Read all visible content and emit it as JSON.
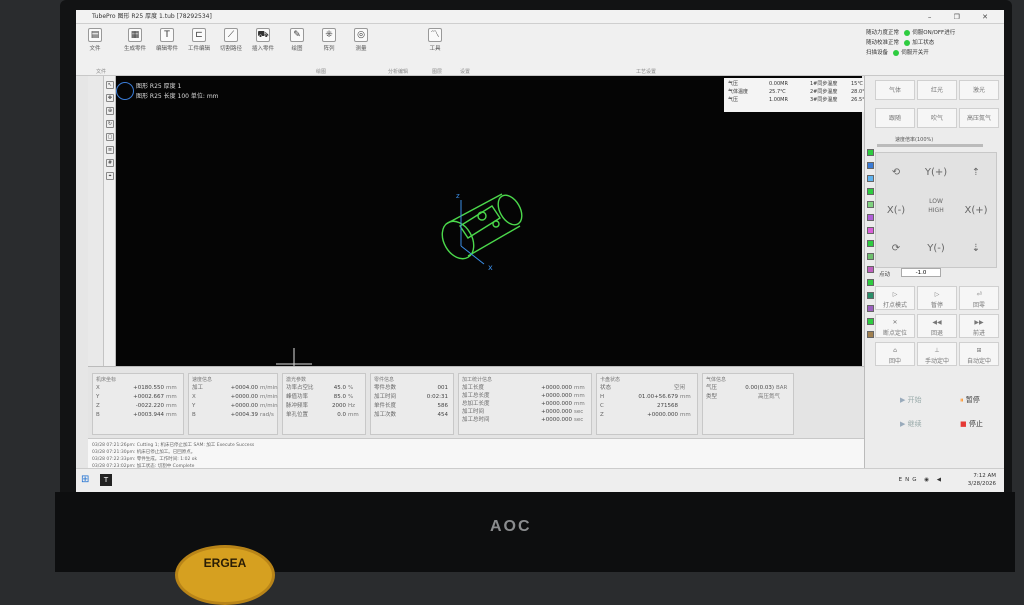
{
  "window": {
    "title": "TubePro 图形 R25 厚度 1.tub [78292534]",
    "controls": "– ❐ ✕"
  },
  "ribbon": {
    "buttons": [
      "文件",
      "生成零件",
      "编辑零件",
      "工件编辑",
      "切割路径",
      "插入零件",
      "绘图",
      "阵列",
      "测量",
      "工具"
    ],
    "groups": [
      "文件",
      "绘图",
      "分析编辑",
      "图层",
      "设置",
      "工艺设置"
    ]
  },
  "status": {
    "items": [
      "随动力度正常",
      "随动校准正常",
      "扫描设备",
      "伺服ON/OFF进行",
      "加工状态",
      "伺服开关开"
    ]
  },
  "part": {
    "line1": "图形 R25 厚度 1",
    "line2": "图形 R25 长度 100 单位: mm"
  },
  "sensors": {
    "rows": [
      [
        "气压",
        "0.00MR",
        "1#同步温度",
        "15℃"
      ],
      [
        "气体温度",
        "25.7℃",
        "2#同步温度",
        "28.0℃"
      ],
      [
        "气压",
        "1.00MR",
        "3#同步温度",
        "26.5℃"
      ]
    ]
  },
  "right_panel": {
    "top_buttons": [
      "气体",
      "红光",
      "激光",
      "跟随",
      "吹气",
      "高压氮气"
    ],
    "jog": {
      "left": "X(-)",
      "right": "X(+)",
      "yplus": "Y(+)",
      "yminus": "Y(-)",
      "low": "LOW",
      "high": "HIGH"
    },
    "speed_label": "速度倍率(100%)",
    "step_label": "点动",
    "step_value": "-1.0",
    "controls": [
      "打点模式",
      "暂停",
      "回零",
      "断点定位",
      "回退",
      "前进",
      "回中",
      "手动定中",
      "自动定中"
    ],
    "actions": {
      "start": "开始",
      "pause": "暂停",
      "continue": "继续",
      "stop": "停止"
    }
  },
  "coords": {
    "header": "机床坐标",
    "rows": [
      [
        "X",
        "+0180.550",
        "mm"
      ],
      [
        "Y",
        "+0002.667",
        "mm"
      ],
      [
        "Z",
        "-0022.220",
        "mm"
      ],
      [
        "B",
        "+0003.944",
        "mm"
      ]
    ]
  },
  "speeds": {
    "header": "速度信息",
    "rows": [
      [
        "加工",
        "+0004.00",
        "m/min"
      ],
      [
        "X",
        "+0000.00",
        "m/min"
      ],
      [
        "Y",
        "+0000.00",
        "m/min"
      ],
      [
        "B",
        "+0004.39",
        "rad/s"
      ]
    ]
  },
  "laser": {
    "header": "激光参数",
    "rows": [
      [
        "功率占空比",
        "45.0",
        "%"
      ],
      [
        "峰值功率",
        "85.0",
        "%"
      ],
      [
        "脉冲频率",
        "2000",
        "Hz"
      ],
      [
        "单孔位置",
        "0.0",
        "mm"
      ]
    ]
  },
  "count": {
    "header": "零件信息",
    "rows": [
      [
        "零件总数",
        "001",
        ""
      ],
      [
        "加工时间",
        "0:02:31",
        ""
      ],
      [
        "单件长度",
        "586",
        ""
      ],
      [
        "加工次数",
        "454",
        ""
      ]
    ]
  },
  "processing": {
    "header": "加工统计信息",
    "rows": [
      [
        "加工长度",
        "+0000.000",
        "mm"
      ],
      [
        "加工总长度",
        "+0000.000",
        "mm"
      ],
      [
        "总加工长度",
        "+0000.000",
        "mm"
      ],
      [
        "加工时间",
        "+0000.000",
        "sec"
      ],
      [
        "加工总时间",
        "+0000.000",
        "sec"
      ]
    ]
  },
  "chuck": {
    "header": "卡盘状态",
    "rows": [
      [
        "状态",
        "",
        "空闲"
      ],
      [
        "H",
        "01.00+56.679",
        "mm"
      ],
      [
        "C",
        "271568",
        ""
      ],
      [
        "Z",
        "+0000.000",
        "mm"
      ]
    ]
  },
  "gas": {
    "header": "气体信息",
    "rows": [
      [
        "气压",
        "0.00(0.03)",
        "BAR"
      ],
      [
        "类型",
        "",
        "高压氮气"
      ]
    ]
  },
  "log": {
    "lines": [
      "03/28 07:21:26pm: Cutting 1; 机床已停止加工 SAM: 加工 Execute Success",
      "03/28 07:21:30pm: 机床已停止加工。已回原点。",
      "03/28 07:22:33pm: 零件生成。工作时间: 1:02 ok",
      "03/28 07:23:02pm: 加工状态: 切割中 Complete"
    ]
  },
  "taskbar": {
    "lang": "ENG",
    "time": "7:12 AM",
    "date": "3/28/2026"
  },
  "colors": {
    "accent_green": "#2ecc40",
    "stop_red": "#e53935",
    "pause_orange": "#ff8c1a",
    "part_green": "#4bd84b"
  },
  "monitor": {
    "brand": "AOC",
    "sticker": "ERGEA"
  }
}
